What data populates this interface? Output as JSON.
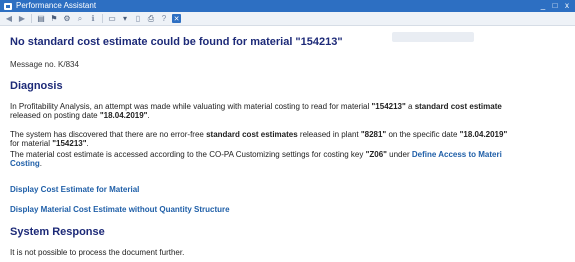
{
  "window": {
    "title": "Performance Assistant",
    "minimize_glyph": "_",
    "maximize_glyph": "□",
    "close_glyph": "x"
  },
  "toolbar": {
    "icons": [
      "back-icon",
      "forward-icon",
      "print-icon",
      "bookmark-icon",
      "settings-icon",
      "find-icon",
      "technical-info-icon",
      "screen-icon",
      "filter-icon",
      "document-icon",
      "printer-icon",
      "help-icon",
      "close-box-icon"
    ]
  },
  "message": {
    "title": "No standard cost estimate could be found for material \"154213\"",
    "message_no": "Message no. K/834"
  },
  "diagnosis": {
    "heading": "Diagnosis",
    "p1_a": "In Profitability Analysis, an attempt was made while valuating with material costing to read for material ",
    "p1_material": "\"154213\"",
    "p1_b": " a ",
    "p1_bold": "standard cost estimate",
    "p1_line2_a": "released on posting date ",
    "p1_date": "\"18.04.2019\"",
    "p1_line2_b": ".",
    "p2_a": "The system has discovered that there are no error-free ",
    "p2_bold": "standard cost estimates",
    "p2_b": " released in plant ",
    "p2_plant": "\"8281\"",
    "p2_c": " on the specific date ",
    "p2_date": "\"18.04.2019\"",
    "p2_line2_a": "for material ",
    "p2_material": "\"154213\"",
    "p2_line2_b": ".",
    "p3_a": "The material cost estimate is accessed according to the CO-PA Customizing settings for costing key ",
    "p3_key": "\"Z06\"",
    "p3_b": " under ",
    "p3_link": "Define Access to Materi",
    "p3_line2_link": "Costing",
    "p3_line2_b": "."
  },
  "links": {
    "display_estimate": "Display Cost Estimate for Material",
    "display_without_qty": "Display Material Cost Estimate without Quantity Structure"
  },
  "response": {
    "heading": "System Response",
    "text": "It is not possible to process the document further."
  }
}
